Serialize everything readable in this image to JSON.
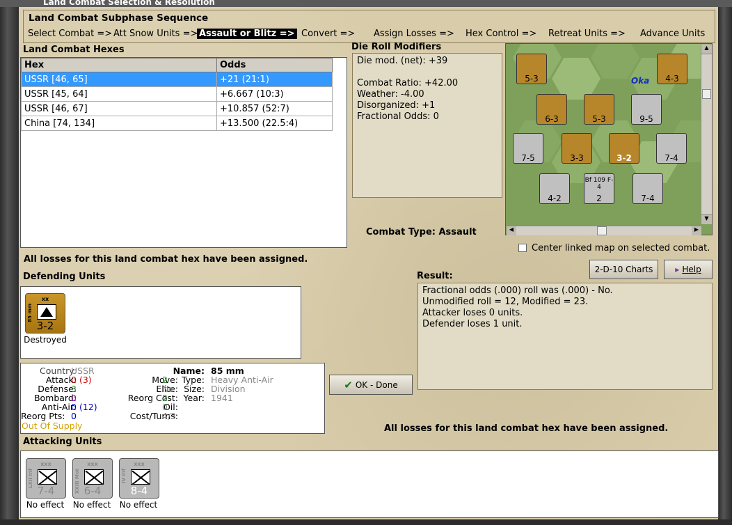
{
  "window": {
    "title": "Land Combat Selection & Resolution"
  },
  "sequence": {
    "title": "Land Combat Subphase Sequence",
    "items": [
      "Select Combat =>",
      "Att Snow Units =>",
      "Assault or Blitz =>",
      "Convert =>",
      "Assign Losses =>",
      "Hex Control =>",
      "Retreat Units =>",
      "Advance Units"
    ],
    "active_index": 2
  },
  "hexes": {
    "label": "Land Combat Hexes",
    "columns": [
      "Hex",
      "Odds"
    ],
    "rows": [
      {
        "hex": "USSR [46, 65]",
        "odds": "+21 (21:1)",
        "selected": true
      },
      {
        "hex": "USSR [45, 64]",
        "odds": "+6.667 (10:3)",
        "selected": false
      },
      {
        "hex": "USSR [46, 67]",
        "odds": "+10.857 (52:7)",
        "selected": false
      },
      {
        "hex": "China [74, 134]",
        "odds": "+13.500 (22.5:4)",
        "selected": false
      }
    ]
  },
  "modifiers": {
    "label": "Die Roll Modifiers",
    "net": "Die mod. (net): +39",
    "combat_ratio": "Combat Ratio: +42.00",
    "weather": "Weather: -4.00",
    "disorganized": "Disorganized: +1",
    "fractional": "Fractional Odds: 0"
  },
  "combat_type": {
    "label": "Combat Type:",
    "value": "Assault"
  },
  "center_map": {
    "label": "Center linked map on selected combat.",
    "checked": false
  },
  "losses_msg": "All losses for this land combat hex have been assigned.",
  "defending": {
    "label": "Defending Units",
    "units": [
      {
        "size": "xx",
        "side_label": "85 mm",
        "strength": "3-2",
        "status": "Destroyed"
      }
    ]
  },
  "unit_info": {
    "country_label": "Country:",
    "country": "USSR",
    "attack_label": "Attack:",
    "attack": "0",
    "attack_extra": "(3)",
    "defense_label": "Defense:",
    "defense": "3",
    "bombard_label": "Bombard:",
    "bombard": "0",
    "antiair_label": "Anti-Air:",
    "antiair": "0",
    "antiair_extra": "(12)",
    "reorg_pts_label": "Reorg Pts:",
    "reorg_pts": "0",
    "supply": "Out Of Supply",
    "move_label": "Move:",
    "move": "2",
    "elite_label": "Elite:",
    "elite": "No",
    "reorg_cost_label": "Reorg Cost:",
    "reorg_cost": "2",
    "oil_label": "Oil:",
    "oil": "0",
    "cost_turns_label": "Cost/Turns:",
    "cost_turns": "4/3",
    "name_label": "Name:",
    "name": "85 mm",
    "type_label": "Type:",
    "type": "Heavy Anti-Air",
    "size_label": "Size:",
    "size": "Division",
    "year_label": "Year:",
    "year": "1941"
  },
  "buttons": {
    "ok": "OK - Done",
    "charts": "2-D-10 Charts",
    "help": "Help"
  },
  "result": {
    "label": "Result:",
    "lines": [
      "Fractional odds (.000) roll was (.000)  - No.",
      "Unmodified roll = 12, Modified = 23.",
      "Attacker loses 0 units.",
      "Defender loses 1 unit."
    ]
  },
  "attacking": {
    "label": "Attacking Units",
    "units": [
      {
        "size": "xxx",
        "side_label": "LXII Inf",
        "strength": "7-4",
        "status": "No effect"
      },
      {
        "size": "xxx",
        "side_label": "XXIII Mot",
        "strength": "6-4",
        "status": "No effect"
      },
      {
        "size": "xxx",
        "side_label": "IV Inf",
        "strength": "8-4",
        "status": "No effect"
      }
    ]
  },
  "map": {
    "label_river": "Oka",
    "units": [
      {
        "size": "xxxx",
        "strength": "5-3",
        "color": "brown"
      },
      {
        "size": "xxxx",
        "strength": "4-3",
        "color": "brown"
      },
      {
        "size": "xxxx",
        "strength": "6-3",
        "color": "brown"
      },
      {
        "size": "xxxx",
        "strength": "5-3",
        "color": "brown"
      },
      {
        "size": "",
        "strength": "9-5",
        "color": "grey"
      },
      {
        "size": "xxx",
        "strength": "7-5",
        "color": "grey"
      },
      {
        "size": "xxxx",
        "strength": "3-3",
        "color": "brown"
      },
      {
        "size": "xx",
        "strength": "3-2",
        "color": "brown"
      },
      {
        "size": "xxx",
        "strength": "7-4",
        "color": "grey"
      },
      {
        "size": "xx",
        "strength": "4-2",
        "color": "grey"
      },
      {
        "size": "Bf 109 F-4",
        "strength": "2",
        "color": "grey"
      },
      {
        "size": "xxx",
        "strength": "7-4",
        "color": "grey"
      }
    ]
  }
}
